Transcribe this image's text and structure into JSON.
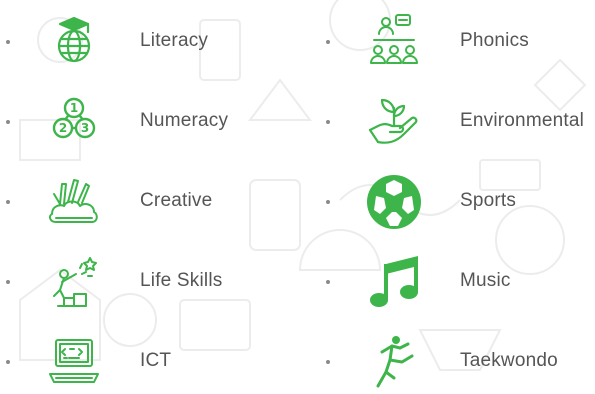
{
  "accent_color": "#3db54a",
  "activities": [
    {
      "label": "Literacy",
      "icon": "graduation-globe-icon"
    },
    {
      "label": "Phonics",
      "icon": "teacher-students-icon"
    },
    {
      "label": "Numeracy",
      "icon": "numbers-123-icon"
    },
    {
      "label": "Environmental",
      "icon": "hand-plant-icon"
    },
    {
      "label": "Creative",
      "icon": "art-supplies-icon"
    },
    {
      "label": "Sports",
      "icon": "soccer-ball-icon"
    },
    {
      "label": "Life Skills",
      "icon": "reaching-star-icon"
    },
    {
      "label": "Music",
      "icon": "music-note-icon"
    },
    {
      "label": "ICT",
      "icon": "laptop-code-icon"
    },
    {
      "label": "Taekwondo",
      "icon": "martial-arts-kick-icon"
    }
  ]
}
